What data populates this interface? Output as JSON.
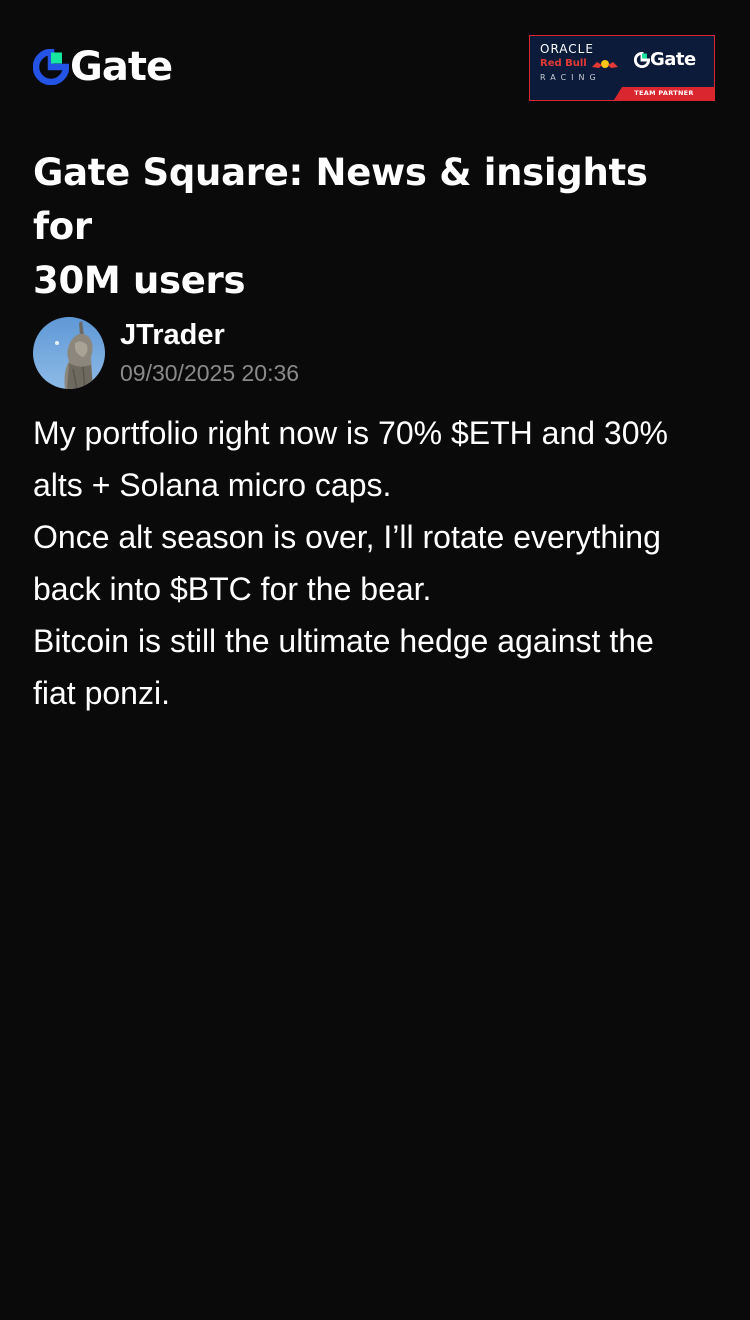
{
  "brand": {
    "logo_text": "Gate",
    "accent_blue": "#2354e6",
    "accent_green": "#17e6a1",
    "icon": "gate-logo-icon"
  },
  "partner_banner": {
    "oracle": "ORACLE",
    "red_bull": "Red Bull",
    "racing": "RACING",
    "gate": "Gate",
    "team_partner": "TEAM PARTNER",
    "background": "#0c1b3a",
    "accent_red": "#d9262f"
  },
  "headline": {
    "line1": "Gate Square: News & insights for",
    "line2": "30M users"
  },
  "post": {
    "author": "JTrader",
    "timestamp": "09/30/2025 20:36",
    "avatar_icon": "avatar-statue-image",
    "lines": [
      "My portfolio right now is 70% $ETH and 30%",
      "alts + Solana micro caps.",
      "Once alt season is over, I’ll rotate everything",
      "back into $BTC for the bear.",
      "Bitcoin is still the ultimate hedge against the",
      "fiat ponzi."
    ]
  },
  "colors": {
    "background": "#0a0a0a",
    "text_primary": "#ffffff",
    "text_secondary": "#8a8a8a"
  }
}
